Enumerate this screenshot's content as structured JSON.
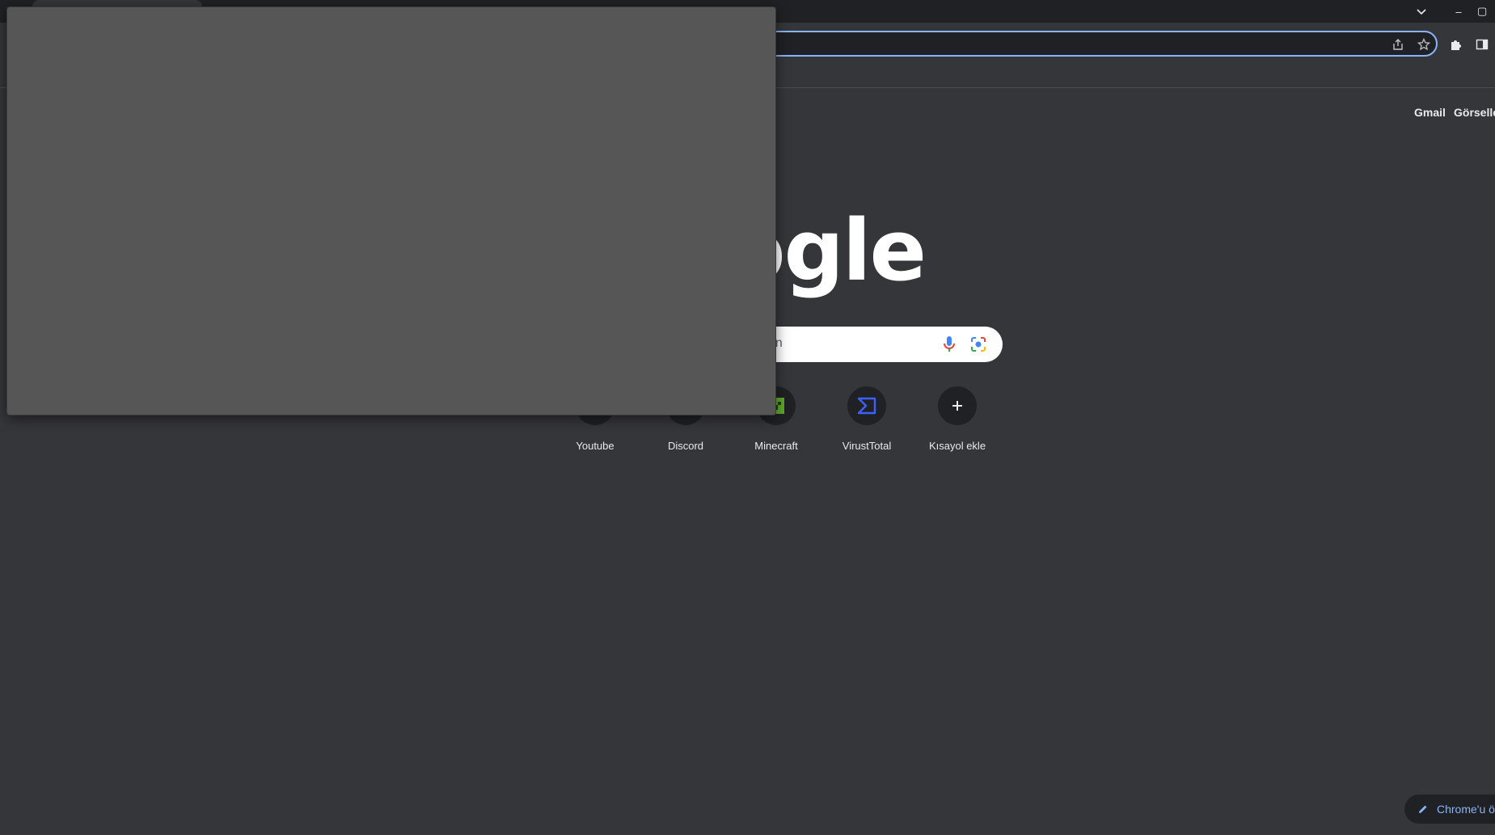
{
  "window": {
    "controls": {
      "minimize": "–",
      "maximize": "▢"
    }
  },
  "header": {
    "gmail": "Gmail",
    "images": "Görseller"
  },
  "logo": {
    "text": "ogle"
  },
  "search": {
    "placeholder_fragment": "an"
  },
  "shortcuts": [
    {
      "label": "Youtube"
    },
    {
      "label": "Discord"
    },
    {
      "label": "Minecraft"
    },
    {
      "label": "VirustTotal"
    },
    {
      "label": "Kısayol ekle"
    }
  ],
  "customize": {
    "label": "Chrome'u öz"
  },
  "colors": {
    "accent": "#8ab4f8",
    "background": "#35363a",
    "overlay": "#565656"
  }
}
